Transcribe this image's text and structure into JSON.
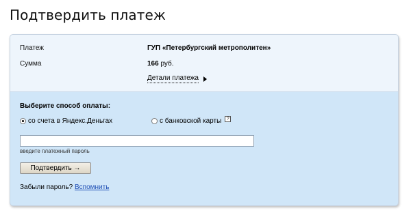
{
  "page": {
    "title": "Подтвердить платеж"
  },
  "details": {
    "payment_label": "Платеж",
    "payment_value": "ГУП «Петербургский метрополитен»",
    "amount_label": "Сумма",
    "amount_value": "166",
    "amount_unit": "руб.",
    "details_link": "Детали платежа"
  },
  "payment_method": {
    "heading": "Выберите способ оплаты:",
    "options": [
      {
        "label": "со счета в Яндекс.Деньгах",
        "checked": true
      },
      {
        "label": "с банковской карты",
        "checked": false
      }
    ],
    "help_glyph": "?"
  },
  "password": {
    "value": "",
    "hint": "введите платежный пароль"
  },
  "confirm_button": "Подтвердить →",
  "forgot": {
    "text": "Забыли пароль?",
    "link": "Вспомнить"
  },
  "colors": {
    "details_bg": "#eef5fc",
    "pay_bg": "#d0e6f8",
    "link": "#1f4fb5"
  }
}
